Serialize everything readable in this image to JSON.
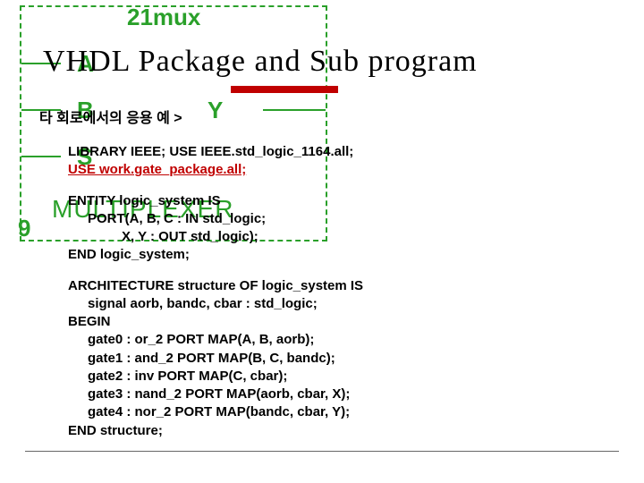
{
  "diagram": {
    "title": "21mux",
    "portA": "A",
    "portB": "B",
    "portS": "S",
    "portY": "Y",
    "mux": "MULTIPLEXER",
    "nine": "9"
  },
  "heading": "VHDL Package and Sub program",
  "section": "타 회로에서의 응용 예 >",
  "code": {
    "l1": "LIBRARY IEEE;  USE IEEE.std_logic_1164.all;",
    "l2": "USE work.gate_package.all;",
    "l3": "ENTITY logic_system IS",
    "l4": "PORT(A, B, C  : IN std_logic;",
    "l5": "X, Y  : OUT std_logic);",
    "l6": "END logic_system;",
    "l7": "ARCHITECTURE structure OF logic_system IS",
    "l8": "signal aorb, bandc, cbar : std_logic;",
    "l9": "BEGIN",
    "l10": "gate0 : or_2    PORT MAP(A, B, aorb);",
    "l11": "gate1 : and_2   PORT MAP(B, C, bandc);",
    "l12": "gate2 : inv     PORT MAP(C, cbar);",
    "l13": "gate3 : nand_2  PORT MAP(aorb, cbar, X);",
    "l14": "gate4 : nor_2   PORT MAP(bandc, cbar, Y);",
    "l15": "END structure;"
  }
}
